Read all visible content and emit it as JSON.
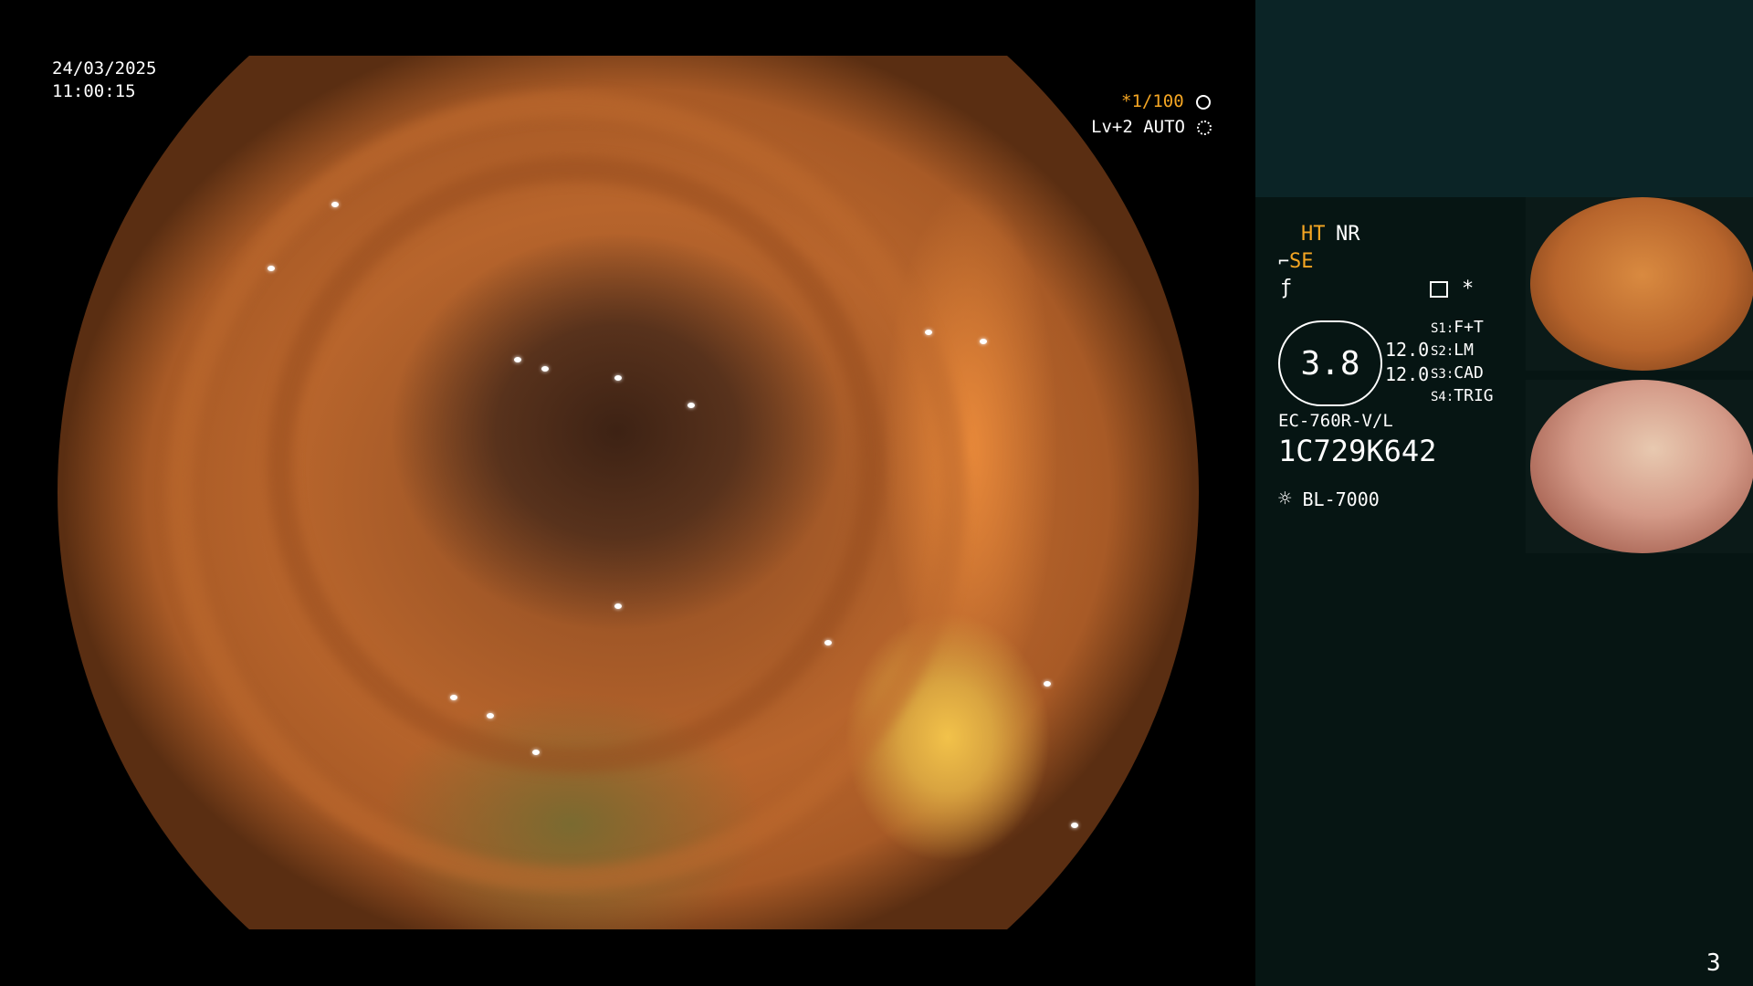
{
  "overlay": {
    "date": "24/03/2025",
    "time": "11:00:15",
    "shutter": "*1/100",
    "enhancement": "Lv+2 AUTO"
  },
  "panel": {
    "ht": "HT",
    "nr": "NR",
    "se": "SE",
    "gauge_value": "3.8",
    "val_top": "12.0",
    "val_bottom": "12.0",
    "switches": [
      {
        "key": "S1:",
        "value": "F+T"
      },
      {
        "key": "S2:",
        "value": "LM"
      },
      {
        "key": "S3:",
        "value": "CAD"
      },
      {
        "key": "S4:",
        "value": "TRIG"
      }
    ],
    "scope_model": "EC-760R-V/L",
    "serial": "1C729K642",
    "light_source": "BL-7000",
    "page_number": "3"
  },
  "colors": {
    "accent_orange": "#f5a623",
    "panel_bg": "#061513",
    "panel_top_bg": "#0b2426"
  },
  "icons": {
    "shutter": "aperture-icon",
    "enhance": "gear-icon",
    "light": "lamp-sun-icon",
    "memo": "list-icon"
  }
}
